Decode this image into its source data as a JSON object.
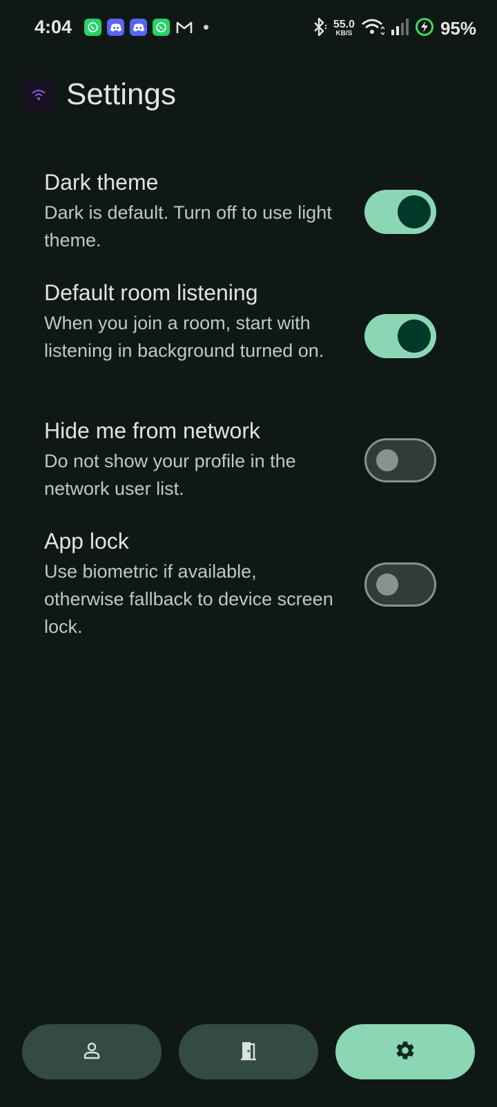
{
  "status_bar": {
    "time": "4:04",
    "net_speed_value": "55.0",
    "net_speed_unit": "KB/S",
    "battery_percent": "95%",
    "notification_icons": [
      "whatsapp-icon",
      "discord-icon",
      "discord-icon",
      "whatsapp-icon",
      "gmail-icon"
    ]
  },
  "header": {
    "title": "Settings"
  },
  "settings": [
    {
      "title": "Dark theme",
      "description": "Dark is default. Turn off to use light theme.",
      "enabled": true
    },
    {
      "title": "Default room listening",
      "description": "When you join a room, start with listening in background turned on.",
      "enabled": true
    },
    {
      "title": "Hide me from network",
      "description": "Do not show your profile in the network user list.",
      "enabled": false
    },
    {
      "title": "App lock",
      "description": "Use biometric if available, otherwise fallback to device screen lock.",
      "enabled": false
    }
  ],
  "bottom_nav": {
    "items": [
      {
        "icon": "person-icon",
        "active": false
      },
      {
        "icon": "door-icon",
        "active": false
      },
      {
        "icon": "gear-icon",
        "active": true
      }
    ]
  },
  "colors": {
    "background": "#101816",
    "accent": "#8bd6b5",
    "nav_inactive": "#334b43"
  }
}
